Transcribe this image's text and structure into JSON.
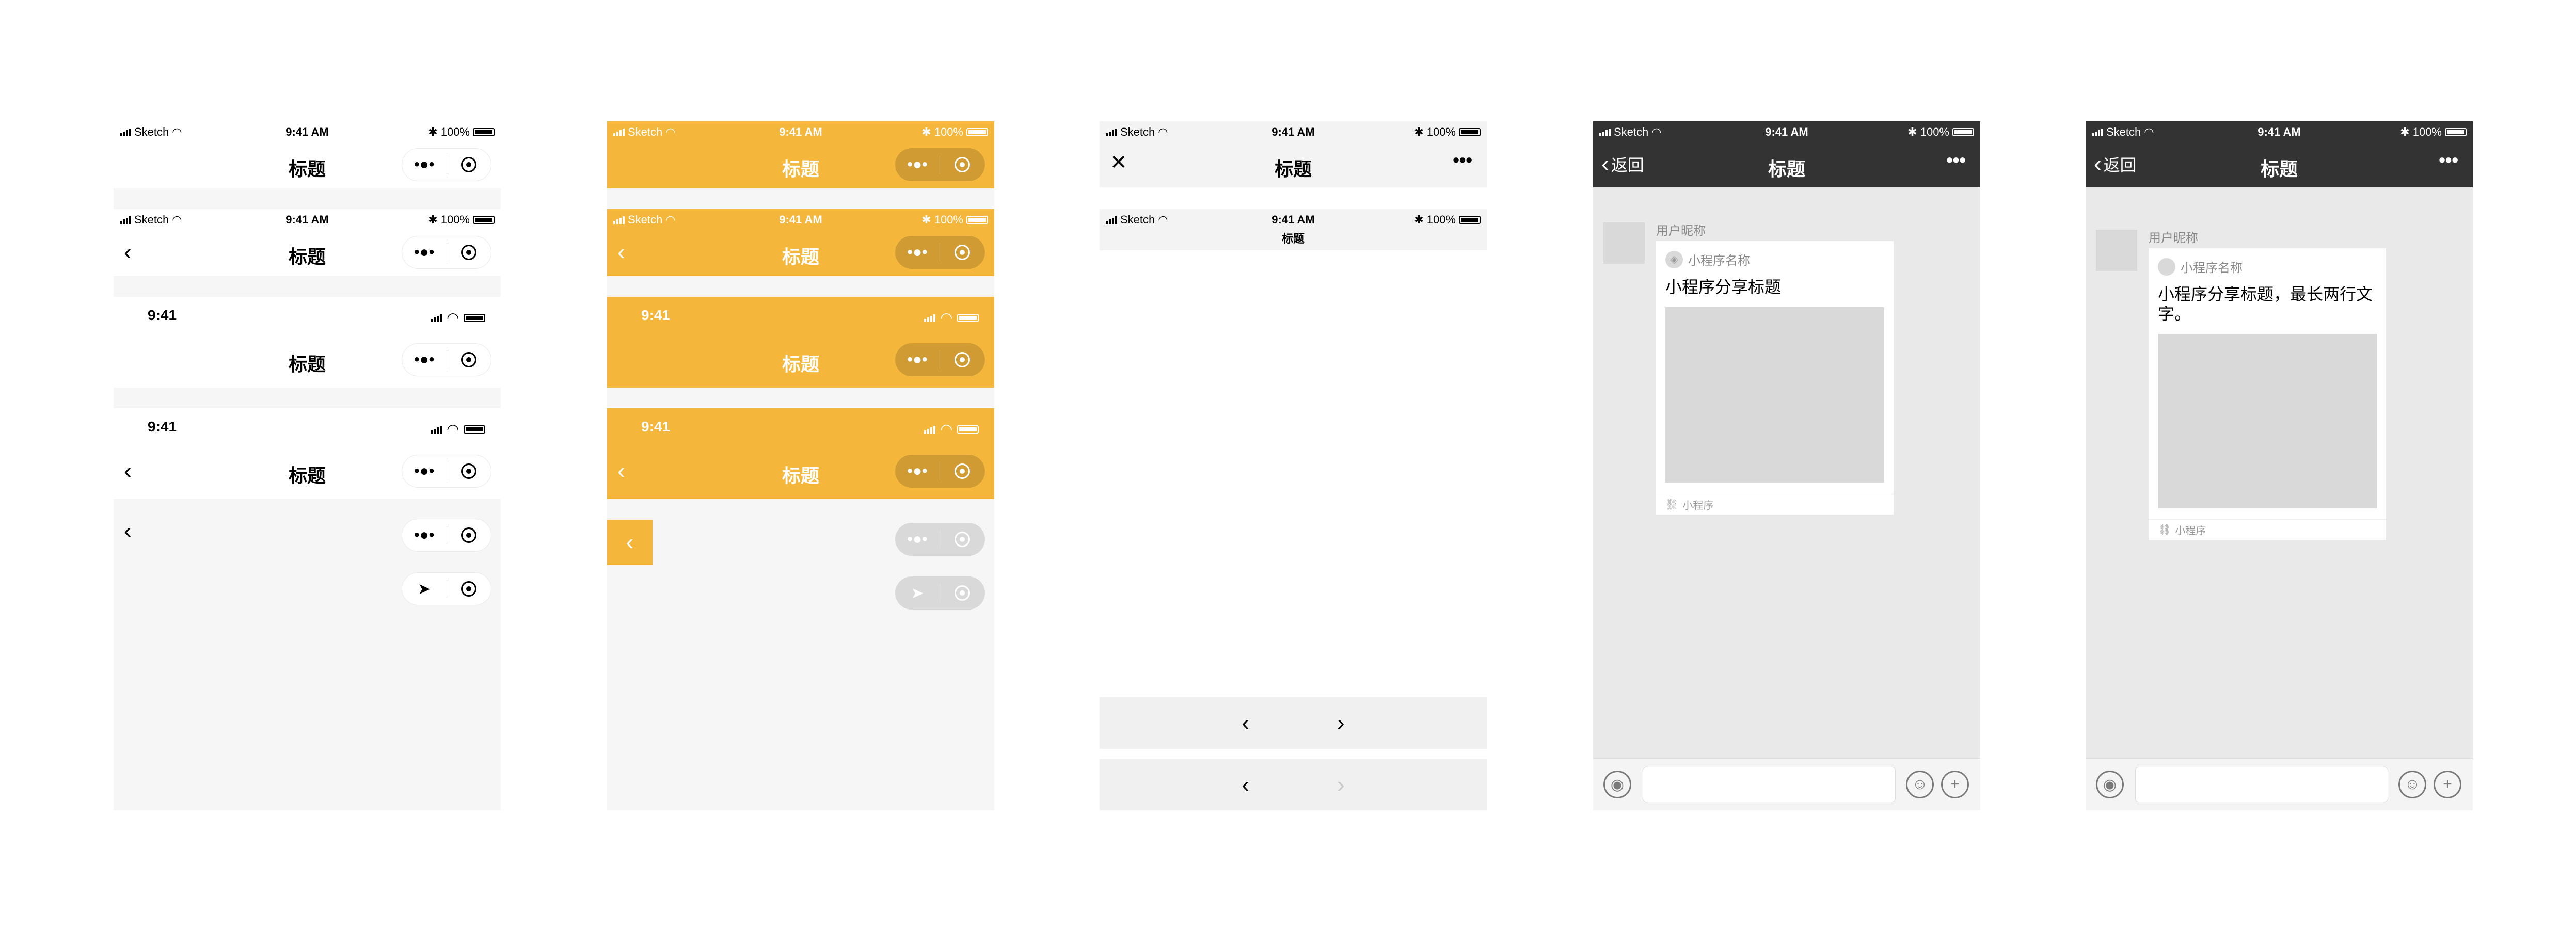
{
  "status": {
    "carrier": "Sketch",
    "time": "9:41 AM",
    "battery": "100%",
    "time_short": "9:41"
  },
  "nav": {
    "title": "标题",
    "back_label": "返回"
  },
  "chat": {
    "nickname": "用户昵称",
    "app_name": "小程序名称",
    "card1_title": "小程序分享标题",
    "card2_title": "小程序分享标题，最长两行文字。",
    "footer": "小程序"
  },
  "icons": {
    "more_dots": "•••",
    "capsule_dots": "•●•",
    "back": "‹",
    "close": "✕",
    "next": "›",
    "send": "➤",
    "plus": "+",
    "emoji": "☺",
    "voice": "◉"
  },
  "colors": {
    "accent": "#f5b73b",
    "dark_nav": "#333333",
    "chat_bg": "#e9e9e9",
    "placeholder_grey": "#d9d9d9"
  }
}
